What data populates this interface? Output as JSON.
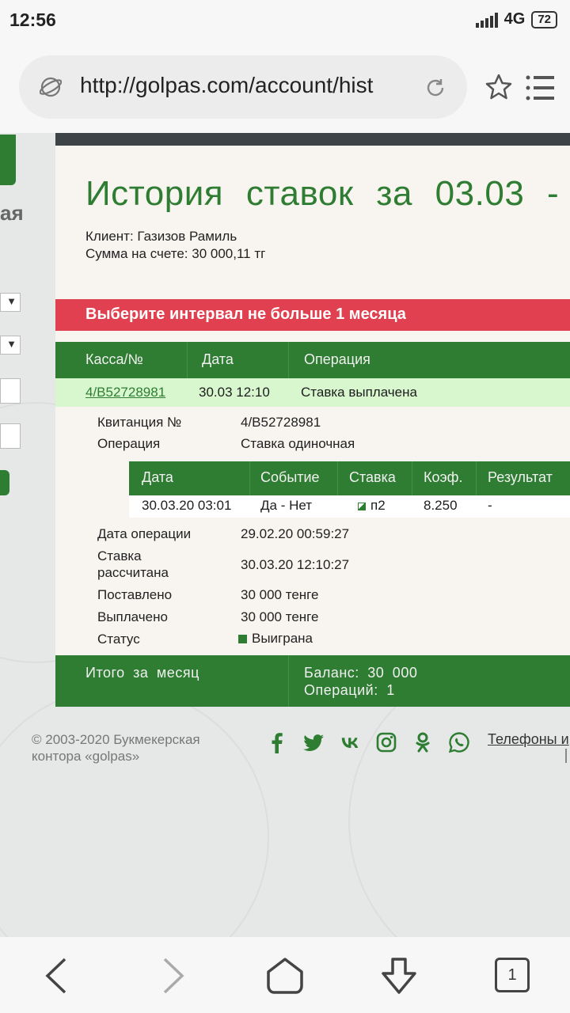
{
  "status_bar": {
    "time": "12:56",
    "network": "4G",
    "battery": "72"
  },
  "browser": {
    "url": "http://golpas.com/account/hist",
    "tab_count": "1"
  },
  "page": {
    "title": "История ставок за 03.03 -",
    "client_line": "Клиент: Газизов Рамиль",
    "balance_line": "Сумма на счете: 30 000,11 тг",
    "alert": "Выберите интервал не больше 1 месяца",
    "side_letters": "ая",
    "table": {
      "headers": [
        "Касса/№",
        "Дата",
        "Операция"
      ],
      "row": {
        "kassa": "4/B52728981",
        "date": "30.03 12:10",
        "operation": "Ставка выплачена"
      }
    },
    "details": {
      "receipt_label": "Квитанция №",
      "receipt_value": "4/B52728981",
      "operation_label": "Операция",
      "operation_value": "Ставка одиночная",
      "inner_headers": [
        "Дата",
        "Событие",
        "Ставка",
        "Коэф.",
        "Результат"
      ],
      "inner_row": {
        "date": "30.03.20 03:01",
        "event": "Да - Нет",
        "bet": "п2",
        "coef": "8.250",
        "result": "-"
      },
      "op_date_label": "Дата операции",
      "op_date_value": "29.02.20 00:59:27",
      "settled_label_1": "Ставка",
      "settled_label_2": "рассчитана",
      "settled_value": "30.03.20 12:10:27",
      "placed_label": "Поставлено",
      "placed_value": "30 000 тенге",
      "paid_label": "Выплачено",
      "paid_value": "30 000 тенге",
      "status_label": "Статус",
      "status_value": "Выиграна"
    },
    "totals": {
      "label": "Итого за месяц",
      "balance": "Баланс: 30 000",
      "operations": "Операций: 1"
    },
    "footer": {
      "copyright_1": "© 2003-2020 Букмекерская",
      "copyright_2": "контора «golpas»",
      "phones_link": "Телефоны и"
    }
  },
  "colors": {
    "brand_green": "#2e7d32",
    "alert_red": "#e0404f",
    "row_highlight": "#d8f7cf"
  }
}
